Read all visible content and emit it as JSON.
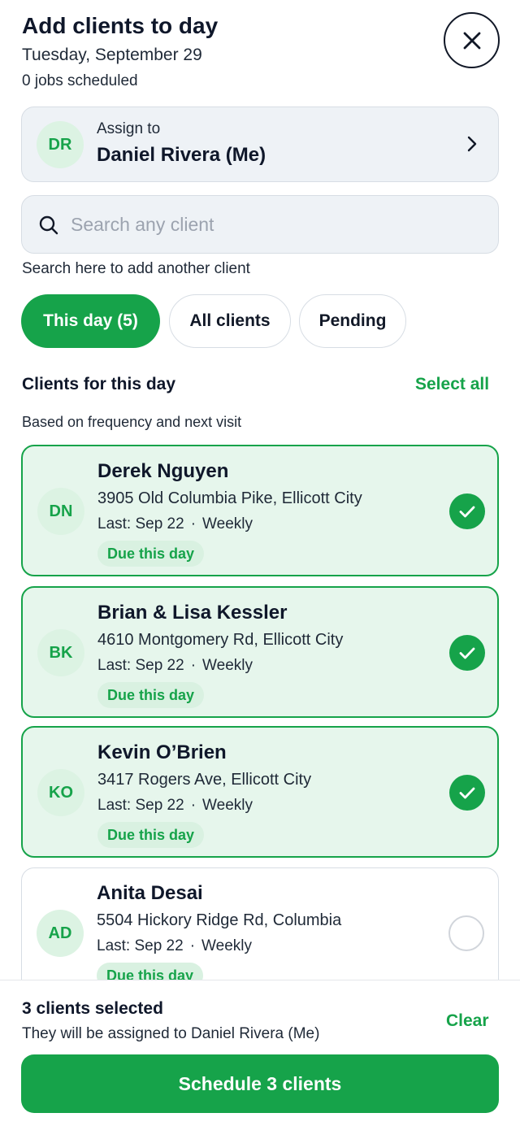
{
  "header": {
    "title": "Add clients to day",
    "date": "Tuesday, September 29",
    "jobs_scheduled": "0 jobs scheduled",
    "close_icon": "close-icon"
  },
  "assign": {
    "label": "Assign to",
    "initials": "DR",
    "name": "Daniel Rivera (Me)",
    "chevron_icon": "chevron-right-icon"
  },
  "search": {
    "placeholder": "Search any client",
    "value": "",
    "hint": "Search here to add another client",
    "icon": "search-icon"
  },
  "tabs": [
    {
      "label": "This day (5)",
      "active": true
    },
    {
      "label": "All clients",
      "active": false
    },
    {
      "label": "Pending",
      "active": false
    }
  ],
  "section": {
    "title": "Clients for this day",
    "select_all": "Select all",
    "subtitle": "Based on frequency and next visit"
  },
  "clients": [
    {
      "initials": "DN",
      "name": "Derek Nguyen",
      "address": "3905 Old Columbia Pike, Ellicott City",
      "last": "Last: Sep 22",
      "frequency": "Weekly",
      "badge": "Due this day",
      "selected": true
    },
    {
      "initials": "BK",
      "name": "Brian & Lisa Kessler",
      "address": "4610 Montgomery Rd, Ellicott City",
      "last": "Last: Sep 22",
      "frequency": "Weekly",
      "badge": "Due this day",
      "selected": true
    },
    {
      "initials": "KO",
      "name": "Kevin O’Brien",
      "address": "3417 Rogers Ave, Ellicott City",
      "last": "Last: Sep 22",
      "frequency": "Weekly",
      "badge": "Due this day",
      "selected": true
    },
    {
      "initials": "AD",
      "name": "Anita Desai",
      "address": "5504 Hickory Ridge Rd, Columbia",
      "last": "Last: Sep 22",
      "frequency": "Weekly",
      "badge": "Due this day",
      "selected": false
    }
  ],
  "meta_separator": "·",
  "footer": {
    "count": "3 clients selected",
    "assign_note": "They will be assigned to Daniel Rivera (Me)",
    "clear": "Clear",
    "schedule": "Schedule 3 clients"
  },
  "colors": {
    "accent": "#16a34a",
    "selected_bg": "#e6f6ec",
    "card_bg": "#eef2f6"
  }
}
